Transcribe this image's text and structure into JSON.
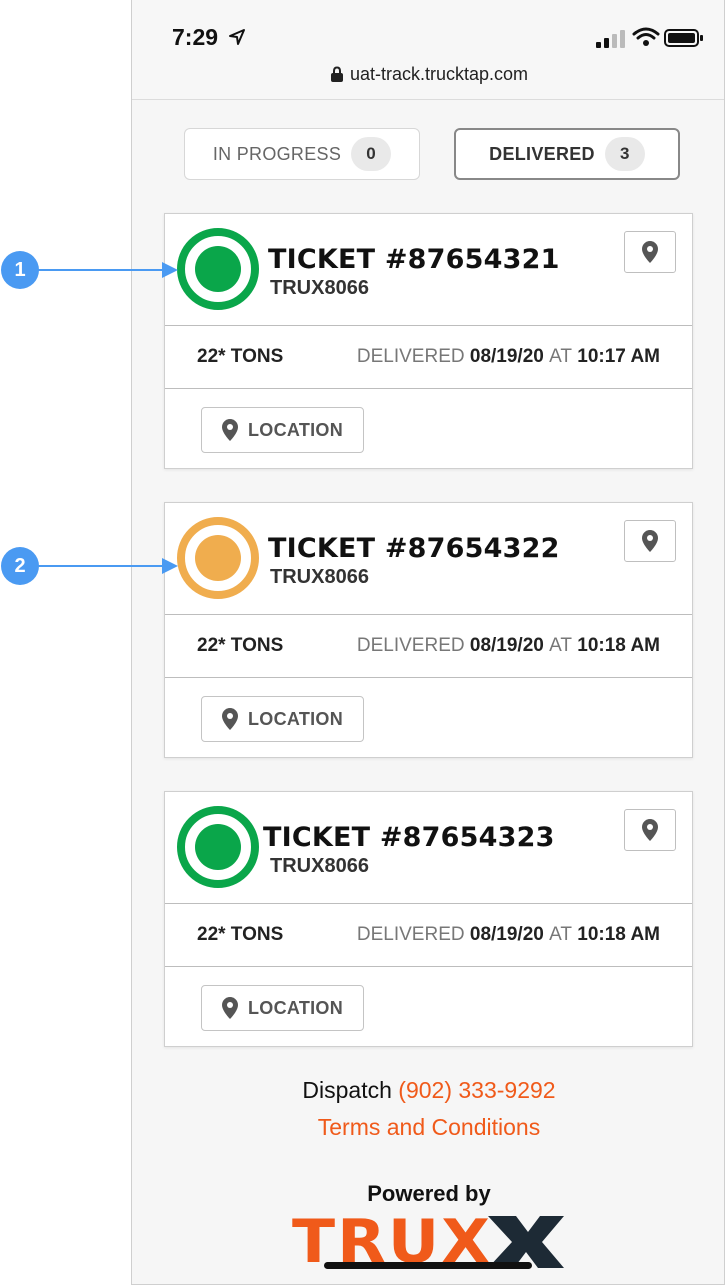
{
  "status_bar": {
    "time": "7:29",
    "url": "uat-track.trucktap.com"
  },
  "tabs": [
    {
      "label": "IN PROGRESS",
      "count": "0",
      "active": false
    },
    {
      "label": "DELIVERED",
      "count": "3",
      "active": true
    }
  ],
  "tickets": [
    {
      "title": "TICKET #87654321",
      "truck": "TRUX8066",
      "tons": "22* TONS",
      "delivered_word": "DELIVERED",
      "date": "08/19/20",
      "at_word": "AT",
      "time": "10:17 AM",
      "location_label": "LOCATION",
      "status_color": "#0aa64a"
    },
    {
      "title": "TICKET #87654322",
      "truck": "TRUX8066",
      "tons": "22* TONS",
      "delivered_word": "DELIVERED",
      "date": "08/19/20",
      "at_word": "AT",
      "time": "10:18 AM",
      "location_label": "LOCATION",
      "status_color": "#f0ad4e"
    },
    {
      "title": "TICKET #87654323",
      "truck": "TRUX8066",
      "tons": "22* TONS",
      "delivered_word": "DELIVERED",
      "date": "08/19/20",
      "at_word": "AT",
      "time": "10:18 AM",
      "location_label": "LOCATION",
      "status_color": "#0aa64a"
    }
  ],
  "footer": {
    "dispatch_label": "Dispatch",
    "dispatch_phone": "(902) 333-9292",
    "terms": "Terms and Conditions",
    "powered_by": "Powered by",
    "logo_text": "TRUX"
  },
  "callouts": [
    {
      "number": "1"
    },
    {
      "number": "2"
    }
  ],
  "colors": {
    "accent": "#f05a1a",
    "callout": "#4a9af2",
    "status_green": "#0aa64a",
    "status_orange": "#f0ad4e"
  }
}
